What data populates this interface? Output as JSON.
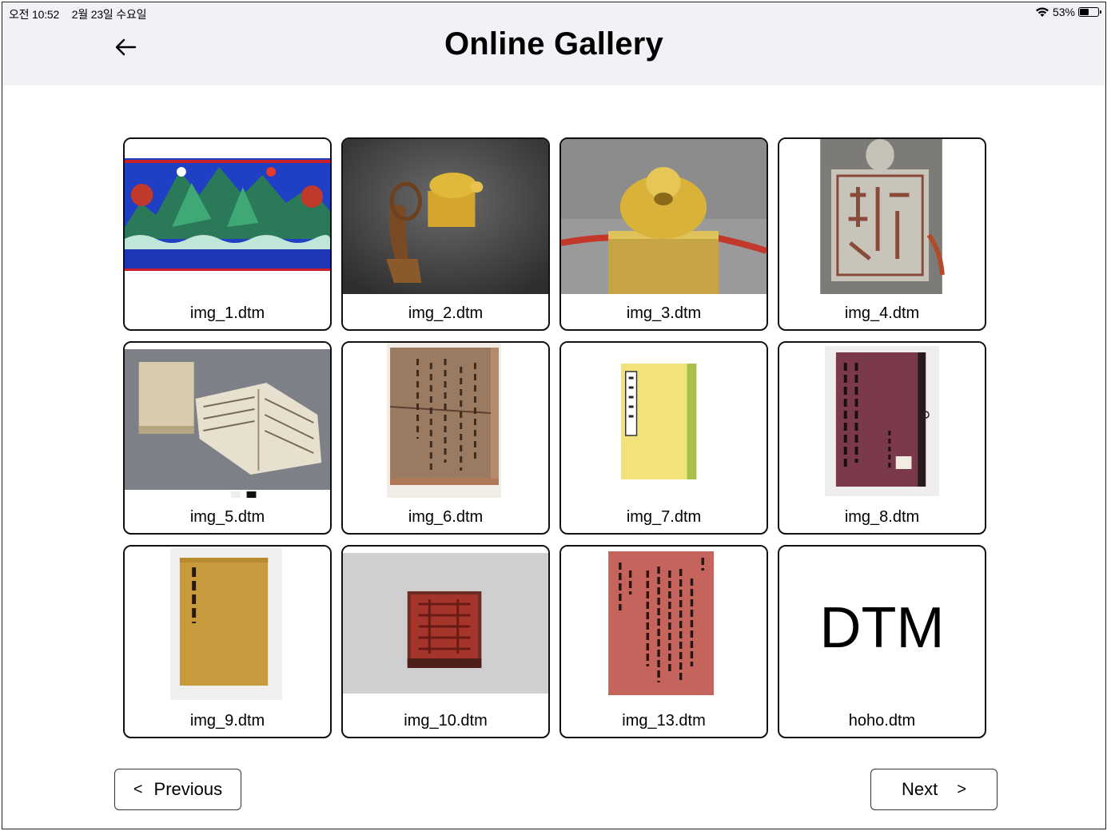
{
  "status_bar": {
    "time": "오전 10:52",
    "date": "2월 23일 수요일",
    "battery_percent": "53%",
    "battery_level": 0.53
  },
  "header": {
    "title": "Online Gallery",
    "back_icon": "arrow-left-icon"
  },
  "gallery": {
    "items": [
      {
        "label": "img_1.dtm"
      },
      {
        "label": "img_2.dtm"
      },
      {
        "label": "img_3.dtm"
      },
      {
        "label": "img_4.dtm"
      },
      {
        "label": "img_5.dtm"
      },
      {
        "label": "img_6.dtm"
      },
      {
        "label": "img_7.dtm"
      },
      {
        "label": "img_8.dtm"
      },
      {
        "label": "img_9.dtm"
      },
      {
        "label": "img_10.dtm"
      },
      {
        "label": "img_13.dtm"
      },
      {
        "label": "hoho.dtm",
        "placeholder_text": "DTM"
      }
    ]
  },
  "pagination": {
    "previous_label": "Previous",
    "previous_chevron": "<",
    "next_label": "Next",
    "next_chevron": ">"
  }
}
